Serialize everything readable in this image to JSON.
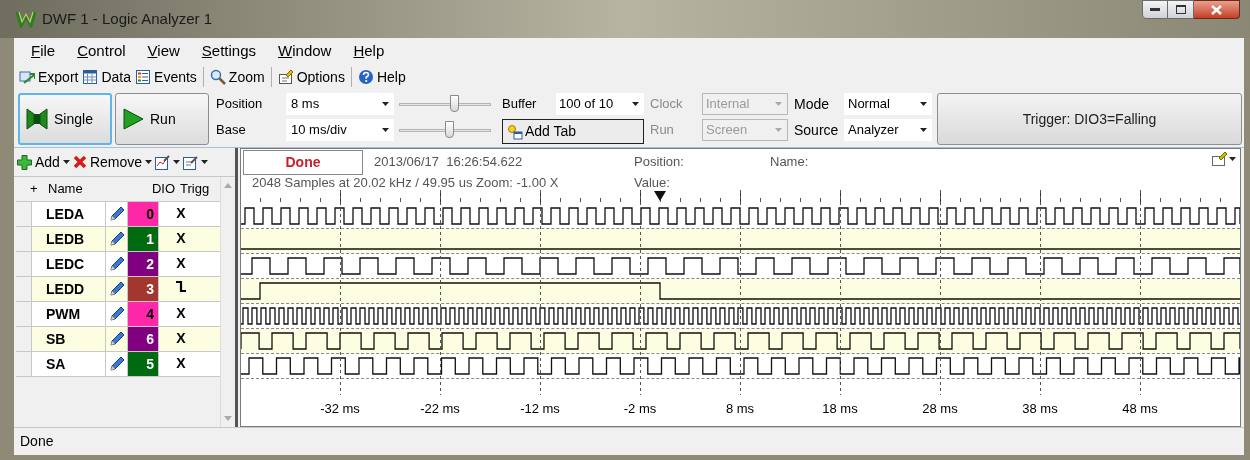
{
  "window": {
    "title": "DWF 1 - Logic Analyzer 1"
  },
  "menu": [
    "File",
    "Control",
    "View",
    "Settings",
    "Window",
    "Help"
  ],
  "toolbar_groups": [
    [
      {
        "kind": "export",
        "label": "Export"
      },
      {
        "kind": "data",
        "label": "Data"
      },
      {
        "kind": "events",
        "label": "Events"
      }
    ],
    [
      {
        "kind": "zoom",
        "label": "Zoom"
      }
    ],
    [
      {
        "kind": "options",
        "label": "Options"
      }
    ],
    [
      {
        "kind": "help",
        "label": "Help"
      }
    ]
  ],
  "acquisition_buttons": [
    {
      "kind": "single",
      "label": "Single",
      "focused": true
    },
    {
      "kind": "run",
      "label": "Run",
      "focused": false
    }
  ],
  "timebase": [
    {
      "label": "Position",
      "value": "8 ms",
      "level": 0.62
    },
    {
      "label": "Base",
      "value": "10 ms/div",
      "level": 0.55
    }
  ],
  "buffer": {
    "label": "Buffer",
    "value": "100 of 10"
  },
  "add_tab": {
    "label": "Add Tab"
  },
  "clock": [
    {
      "label": "Clock",
      "value": "Internal",
      "disabled": true
    },
    {
      "label": "Run",
      "value": "Screen",
      "disabled": true
    }
  ],
  "mode": [
    {
      "label": "Mode",
      "value": "Normal"
    },
    {
      "label": "Source",
      "value": "Analyzer"
    }
  ],
  "trigger_button": {
    "label": "Trigger: DIO3=Falling"
  },
  "channel_toolbar": [
    {
      "kind": "add",
      "label": "Add"
    },
    {
      "kind": "remove",
      "label": "Remove"
    },
    {
      "kind": "chart"
    },
    {
      "kind": "edit"
    }
  ],
  "channel_table": {
    "columns": [
      "+",
      "Name",
      "DIO",
      "Trigg"
    ],
    "rows": [
      {
        "name": "LEDA",
        "dio": "0",
        "color": "#ff28a8",
        "trigger": {
          "kind": "ignore",
          "text": "X"
        }
      },
      {
        "name": "LEDB",
        "dio": "1",
        "color": "#006a10",
        "trigger": {
          "kind": "ignore",
          "text": "X"
        }
      },
      {
        "name": "LEDC",
        "dio": "2",
        "color": "#800080",
        "trigger": {
          "kind": "ignore",
          "text": "X"
        }
      },
      {
        "name": "LEDD",
        "dio": "3",
        "color": "#a3362e",
        "trigger": {
          "kind": "falling"
        }
      },
      {
        "name": "PWM",
        "dio": "4",
        "color": "#ff28a8",
        "trigger": {
          "kind": "ignore",
          "text": "X"
        }
      },
      {
        "name": "SB",
        "dio": "6",
        "color": "#800080",
        "trigger": {
          "kind": "ignore",
          "text": "X"
        }
      },
      {
        "name": "SA",
        "dio": "5",
        "color": "#006a10",
        "trigger": {
          "kind": "ignore",
          "text": "X"
        }
      }
    ]
  },
  "plot": {
    "status": "Done",
    "timestamp": "2013/06/17  16:26:54.622",
    "samples": "2048 Samples at 20.02 kHz / 49.95 us Zoom: -1.00 X",
    "position_label": "Position:",
    "value_label": "Value:",
    "name_label": "Name:",
    "time_labels": [
      "-32 ms",
      "-22 ms",
      "-12 ms",
      "-2 ms",
      "8 ms",
      "18 ms",
      "28 ms",
      "38 ms",
      "48 ms"
    ]
  },
  "status_bar": {
    "text": "Done"
  }
}
